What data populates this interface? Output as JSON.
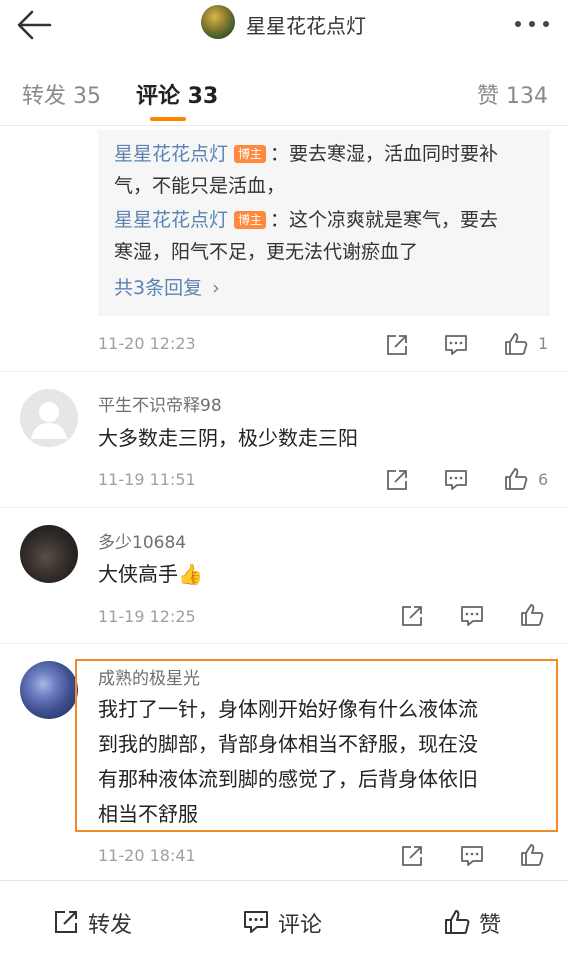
{
  "header": {
    "title": "星星花花点灯"
  },
  "tabs": {
    "repost_label": "转发 35",
    "comments_label": "评论 33",
    "likes_label": "赞 134",
    "active": "comments",
    "accent_color": "#ff8200"
  },
  "reply_block": {
    "line1_user": "星星花花点灯",
    "line1_badge": "博主",
    "line1_text_a": "：要去寒湿，活血同时要补",
    "line1_text_b": "气，不能只是活血，",
    "line2_user": "星星花花点灯",
    "line2_badge": "博主",
    "line2_text_a": "：这个凉爽就是寒气，要去",
    "line2_text_b": "寒湿，阳气不足，更无法代谢瘀血了",
    "more_label": "共3条回复",
    "time": "11-20 12:23",
    "like_count": "1"
  },
  "comments": [
    {
      "user": "平生不识帝释98",
      "text": "大多数走三阴，极少数走三阳",
      "time": "11-19 11:51",
      "like_count": "6",
      "avatar": "default-avatar"
    },
    {
      "user": "多少10684",
      "text": "大侠高手👍",
      "time": "11-19 12:25",
      "like_count": "",
      "avatar": "cat-photo-avatar"
    },
    {
      "user": "成熟的极星光",
      "text_lines": [
        "我打了一针，身体刚开始好像有什么液体流",
        "到我的脚部，背部身体相当不舒服，现在没",
        "有那种液体流到脚的感觉了，后背身体依旧",
        "相当不舒服"
      ],
      "time": "11-20 18:41",
      "like_count": "",
      "avatar": "night-sky-avatar",
      "highlight_color": "#f08a2a"
    }
  ],
  "bottom_bar": {
    "repost_label": "转发",
    "comment_label": "评论",
    "like_label": "赞"
  },
  "icons": {
    "back": "back-arrow-icon",
    "more": "more-dots-icon",
    "share": "share-icon",
    "comment": "comment-icon",
    "like": "thumbs-up-icon"
  }
}
